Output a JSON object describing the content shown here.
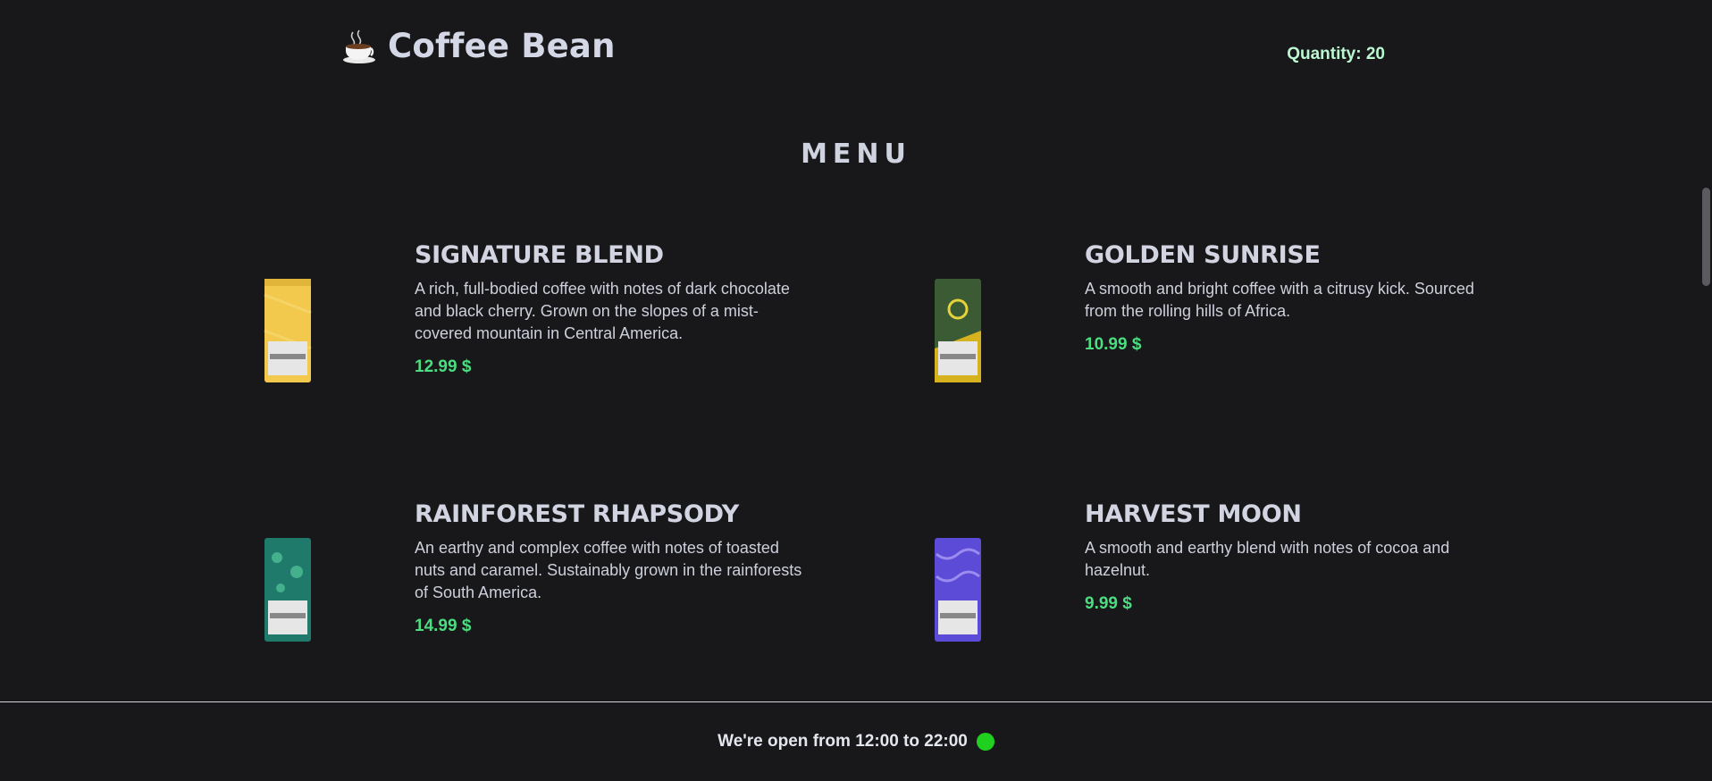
{
  "header": {
    "logo_icon": "coffee-cup-icon",
    "title": "Coffee Bean",
    "quantity_text": "Quantity: 20"
  },
  "menu": {
    "title": "MENU"
  },
  "products": [
    {
      "name": "SIGNATURE BLEND",
      "description": "A rich, full-bodied coffee with notes of dark chocolate and black cherry. Grown on the slopes of a mist-covered mountain in Central America.",
      "price": "12.99 $",
      "bag_color": "#f2c94c"
    },
    {
      "name": "GOLDEN SUNRISE",
      "description": "A smooth and bright coffee with a citrusy kick. Sourced from the rolling hills of Africa.",
      "price": "10.99 $",
      "bag_color": "#3b5b34"
    },
    {
      "name": "RAINFOREST RHAPSODY",
      "description": "An earthy and complex coffee with notes of toasted nuts and caramel. Sustainably grown in the rainforests of South America.",
      "price": "14.99 $",
      "bag_color": "#1f7a6b"
    },
    {
      "name": "HARVEST MOON",
      "description": "A smooth and earthy blend with notes of cocoa and hazelnut.",
      "price": "9.99 $",
      "bag_color": "#5b4bd6"
    }
  ],
  "footer": {
    "hours_text": "We're open from 12:00 to 22:00",
    "status_color": "#1fd01f"
  },
  "colors": {
    "background": "#18181b",
    "price": "#4ade80",
    "quantity": "#bbf7d0"
  }
}
